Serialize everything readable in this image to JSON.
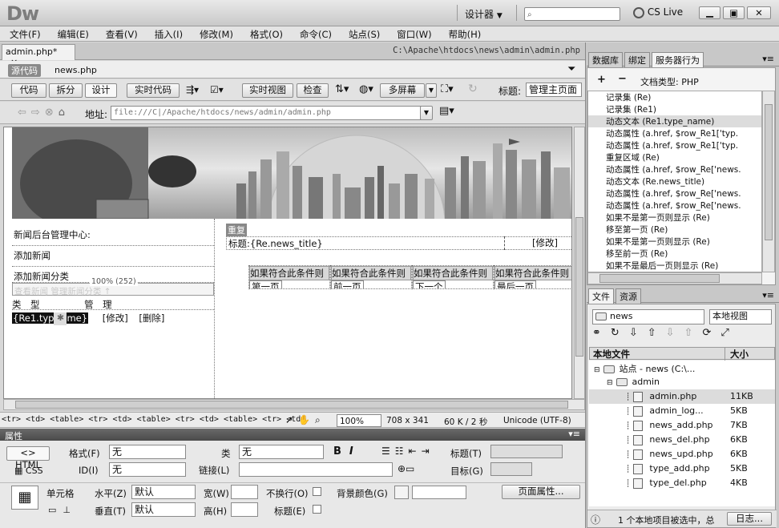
{
  "app": {
    "logo": "Dw",
    "workspace": "设计器",
    "search_placeholder": "",
    "cslive": "CS Live"
  },
  "menu": [
    "文件(F)",
    "编辑(E)",
    "查看(V)",
    "插入(I)",
    "修改(M)",
    "格式(O)",
    "命令(C)",
    "站点(S)",
    "窗口(W)",
    "帮助(H)"
  ],
  "document": {
    "tab": "admin.php*",
    "path": "C:\\Apache\\htdocs\\news\\admin\\admin.php",
    "source_code": "源代码",
    "related_file": "news.php"
  },
  "toolbar": {
    "code": "代码",
    "split": "拆分",
    "design": "设计",
    "live_code": "实时代码",
    "live_view": "实时视图",
    "inspect": "检查",
    "multiscreen": "多屏幕",
    "title_label": "标题:",
    "title_value": "管理主页面"
  },
  "address": {
    "label": "地址:",
    "value": "file:///C|/Apache/htdocs/news/admin/admin.php"
  },
  "design": {
    "left_rows": [
      "新闻后台管理中心:",
      "添加新闻",
      "添加新闻分类"
    ],
    "ghost_text": "查看新闻    管理新闻分类 ↑",
    "width_label": "100% (252)",
    "type_header": "类　型",
    "manage_header": "管　理",
    "dyn_type": "{Re1.typ",
    "dyn_type_end": "me}",
    "edit_link": "[修改]",
    "delete_link": "[删除]",
    "repeat_label": "重复",
    "title_prefix": "标题:",
    "news_title": "{Re.news_title}",
    "right_edit": "[修改]",
    "cond_text": "如果符合此条件则",
    "pages": [
      "第一页",
      "前一页",
      "下一个",
      "最后一页"
    ]
  },
  "statusbar": {
    "tags": "<tr> <td> <table> <tr> <td> <table> <tr> <td> <table> <tr> <td>",
    "zoom": "100%",
    "size": "708 x 341",
    "weight": "60 K / 2 秒",
    "encoding": "Unicode (UTF-8)"
  },
  "properties": {
    "header": "属性",
    "html": "HTML",
    "css": "CSS",
    "format_label": "格式(F)",
    "format_value": "无",
    "class_label": "类",
    "class_value": "无",
    "id_label": "ID(I)",
    "id_value": "无",
    "link_label": "链接(L)",
    "title_label": "标题(T)",
    "target_label": "目标(G)",
    "cell_label": "单元格",
    "horz_label": "水平(Z)",
    "horz_value": "默认",
    "vert_label": "垂直(T)",
    "vert_value": "默认",
    "width_label": "宽(W)",
    "height_label": "高(H)",
    "nowrap_label": "不换行(O)",
    "header_label": "标题(E)",
    "bg_label": "背景颜色(G)",
    "page_props": "页面属性..."
  },
  "server_panel": {
    "tabs": [
      "数据库",
      "绑定",
      "服务器行为"
    ],
    "plus": "+",
    "minus": "−",
    "doc_type": "文档类型: PHP",
    "items": [
      "记录集 (Re)",
      "记录集 (Re1)",
      "动态文本 (Re1.type_name)",
      "动态属性 (a.href, $row_Re1['typ.",
      "动态属性 (a.href, $row_Re1['typ.",
      "重复区域 (Re)",
      "动态属性 (a.href, $row_Re['news.",
      "动态文本 (Re.news_title)",
      "动态属性 (a.href, $row_Re['news.",
      "动态属性 (a.href, $row_Re['news.",
      "如果不是第一页则显示 (Re)",
      "移至第一页 (Re)",
      "如果不是第一页则显示 (Re)",
      "移至前一页 (Re)",
      "如果不是最后一页则显示 (Re)"
    ]
  },
  "files_panel": {
    "tabs": [
      "文件",
      "资源"
    ],
    "site": "news",
    "view": "本地视图",
    "col_local": "本地文件",
    "col_size": "大小",
    "tree": [
      {
        "name": "站点 - news (C:\\...",
        "size": ""
      },
      {
        "name": "admin",
        "size": ""
      },
      {
        "name": "admin.php",
        "size": "11KB"
      },
      {
        "name": "admin_log...",
        "size": "5KB"
      },
      {
        "name": "news_add.php",
        "size": "7KB"
      },
      {
        "name": "news_del.php",
        "size": "6KB"
      },
      {
        "name": "news_upd.php",
        "size": "6KB"
      },
      {
        "name": "type_add.php",
        "size": "5KB"
      },
      {
        "name": "type_del.php",
        "size": "4KB"
      }
    ],
    "status": "1 个本地项目被选中，总",
    "log": "日志..."
  },
  "colors": {
    "accent": "#4a4a4a",
    "selected": "#dcdcdc"
  }
}
